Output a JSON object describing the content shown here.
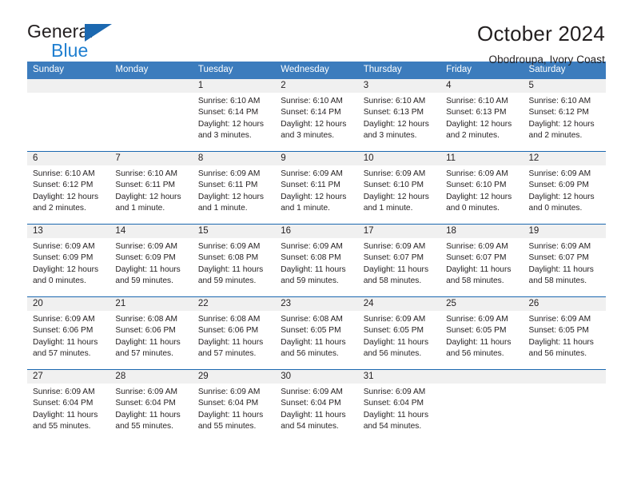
{
  "brand": {
    "name_top": "General",
    "name_bottom": "Blue",
    "triangle_color": "#1b68b0",
    "blue_color": "#1f7fd0"
  },
  "header": {
    "title": "October 2024",
    "subtitle": "Obodroupa, Ivory Coast"
  },
  "theme": {
    "header_bg": "#3c7cbd",
    "header_text": "#ffffff",
    "row_divider": "#1b68b0",
    "day_number_bg": "#f0f0f0",
    "text": "#231f20"
  },
  "calendar": {
    "weekday_headers": [
      "Sunday",
      "Monday",
      "Tuesday",
      "Wednesday",
      "Thursday",
      "Friday",
      "Saturday"
    ],
    "weeks": [
      [
        {
          "day": "",
          "lines": []
        },
        {
          "day": "",
          "lines": []
        },
        {
          "day": "1",
          "lines": [
            "Sunrise: 6:10 AM",
            "Sunset: 6:14 PM",
            "Daylight: 12 hours",
            "and 3 minutes."
          ]
        },
        {
          "day": "2",
          "lines": [
            "Sunrise: 6:10 AM",
            "Sunset: 6:14 PM",
            "Daylight: 12 hours",
            "and 3 minutes."
          ]
        },
        {
          "day": "3",
          "lines": [
            "Sunrise: 6:10 AM",
            "Sunset: 6:13 PM",
            "Daylight: 12 hours",
            "and 3 minutes."
          ]
        },
        {
          "day": "4",
          "lines": [
            "Sunrise: 6:10 AM",
            "Sunset: 6:13 PM",
            "Daylight: 12 hours",
            "and 2 minutes."
          ]
        },
        {
          "day": "5",
          "lines": [
            "Sunrise: 6:10 AM",
            "Sunset: 6:12 PM",
            "Daylight: 12 hours",
            "and 2 minutes."
          ]
        }
      ],
      [
        {
          "day": "6",
          "lines": [
            "Sunrise: 6:10 AM",
            "Sunset: 6:12 PM",
            "Daylight: 12 hours",
            "and 2 minutes."
          ]
        },
        {
          "day": "7",
          "lines": [
            "Sunrise: 6:10 AM",
            "Sunset: 6:11 PM",
            "Daylight: 12 hours",
            "and 1 minute."
          ]
        },
        {
          "day": "8",
          "lines": [
            "Sunrise: 6:09 AM",
            "Sunset: 6:11 PM",
            "Daylight: 12 hours",
            "and 1 minute."
          ]
        },
        {
          "day": "9",
          "lines": [
            "Sunrise: 6:09 AM",
            "Sunset: 6:11 PM",
            "Daylight: 12 hours",
            "and 1 minute."
          ]
        },
        {
          "day": "10",
          "lines": [
            "Sunrise: 6:09 AM",
            "Sunset: 6:10 PM",
            "Daylight: 12 hours",
            "and 1 minute."
          ]
        },
        {
          "day": "11",
          "lines": [
            "Sunrise: 6:09 AM",
            "Sunset: 6:10 PM",
            "Daylight: 12 hours",
            "and 0 minutes."
          ]
        },
        {
          "day": "12",
          "lines": [
            "Sunrise: 6:09 AM",
            "Sunset: 6:09 PM",
            "Daylight: 12 hours",
            "and 0 minutes."
          ]
        }
      ],
      [
        {
          "day": "13",
          "lines": [
            "Sunrise: 6:09 AM",
            "Sunset: 6:09 PM",
            "Daylight: 12 hours",
            "and 0 minutes."
          ]
        },
        {
          "day": "14",
          "lines": [
            "Sunrise: 6:09 AM",
            "Sunset: 6:09 PM",
            "Daylight: 11 hours",
            "and 59 minutes."
          ]
        },
        {
          "day": "15",
          "lines": [
            "Sunrise: 6:09 AM",
            "Sunset: 6:08 PM",
            "Daylight: 11 hours",
            "and 59 minutes."
          ]
        },
        {
          "day": "16",
          "lines": [
            "Sunrise: 6:09 AM",
            "Sunset: 6:08 PM",
            "Daylight: 11 hours",
            "and 59 minutes."
          ]
        },
        {
          "day": "17",
          "lines": [
            "Sunrise: 6:09 AM",
            "Sunset: 6:07 PM",
            "Daylight: 11 hours",
            "and 58 minutes."
          ]
        },
        {
          "day": "18",
          "lines": [
            "Sunrise: 6:09 AM",
            "Sunset: 6:07 PM",
            "Daylight: 11 hours",
            "and 58 minutes."
          ]
        },
        {
          "day": "19",
          "lines": [
            "Sunrise: 6:09 AM",
            "Sunset: 6:07 PM",
            "Daylight: 11 hours",
            "and 58 minutes."
          ]
        }
      ],
      [
        {
          "day": "20",
          "lines": [
            "Sunrise: 6:09 AM",
            "Sunset: 6:06 PM",
            "Daylight: 11 hours",
            "and 57 minutes."
          ]
        },
        {
          "day": "21",
          "lines": [
            "Sunrise: 6:08 AM",
            "Sunset: 6:06 PM",
            "Daylight: 11 hours",
            "and 57 minutes."
          ]
        },
        {
          "day": "22",
          "lines": [
            "Sunrise: 6:08 AM",
            "Sunset: 6:06 PM",
            "Daylight: 11 hours",
            "and 57 minutes."
          ]
        },
        {
          "day": "23",
          "lines": [
            "Sunrise: 6:08 AM",
            "Sunset: 6:05 PM",
            "Daylight: 11 hours",
            "and 56 minutes."
          ]
        },
        {
          "day": "24",
          "lines": [
            "Sunrise: 6:09 AM",
            "Sunset: 6:05 PM",
            "Daylight: 11 hours",
            "and 56 minutes."
          ]
        },
        {
          "day": "25",
          "lines": [
            "Sunrise: 6:09 AM",
            "Sunset: 6:05 PM",
            "Daylight: 11 hours",
            "and 56 minutes."
          ]
        },
        {
          "day": "26",
          "lines": [
            "Sunrise: 6:09 AM",
            "Sunset: 6:05 PM",
            "Daylight: 11 hours",
            "and 56 minutes."
          ]
        }
      ],
      [
        {
          "day": "27",
          "lines": [
            "Sunrise: 6:09 AM",
            "Sunset: 6:04 PM",
            "Daylight: 11 hours",
            "and 55 minutes."
          ]
        },
        {
          "day": "28",
          "lines": [
            "Sunrise: 6:09 AM",
            "Sunset: 6:04 PM",
            "Daylight: 11 hours",
            "and 55 minutes."
          ]
        },
        {
          "day": "29",
          "lines": [
            "Sunrise: 6:09 AM",
            "Sunset: 6:04 PM",
            "Daylight: 11 hours",
            "and 55 minutes."
          ]
        },
        {
          "day": "30",
          "lines": [
            "Sunrise: 6:09 AM",
            "Sunset: 6:04 PM",
            "Daylight: 11 hours",
            "and 54 minutes."
          ]
        },
        {
          "day": "31",
          "lines": [
            "Sunrise: 6:09 AM",
            "Sunset: 6:04 PM",
            "Daylight: 11 hours",
            "and 54 minutes."
          ]
        },
        {
          "day": "",
          "lines": []
        },
        {
          "day": "",
          "lines": []
        }
      ]
    ]
  }
}
